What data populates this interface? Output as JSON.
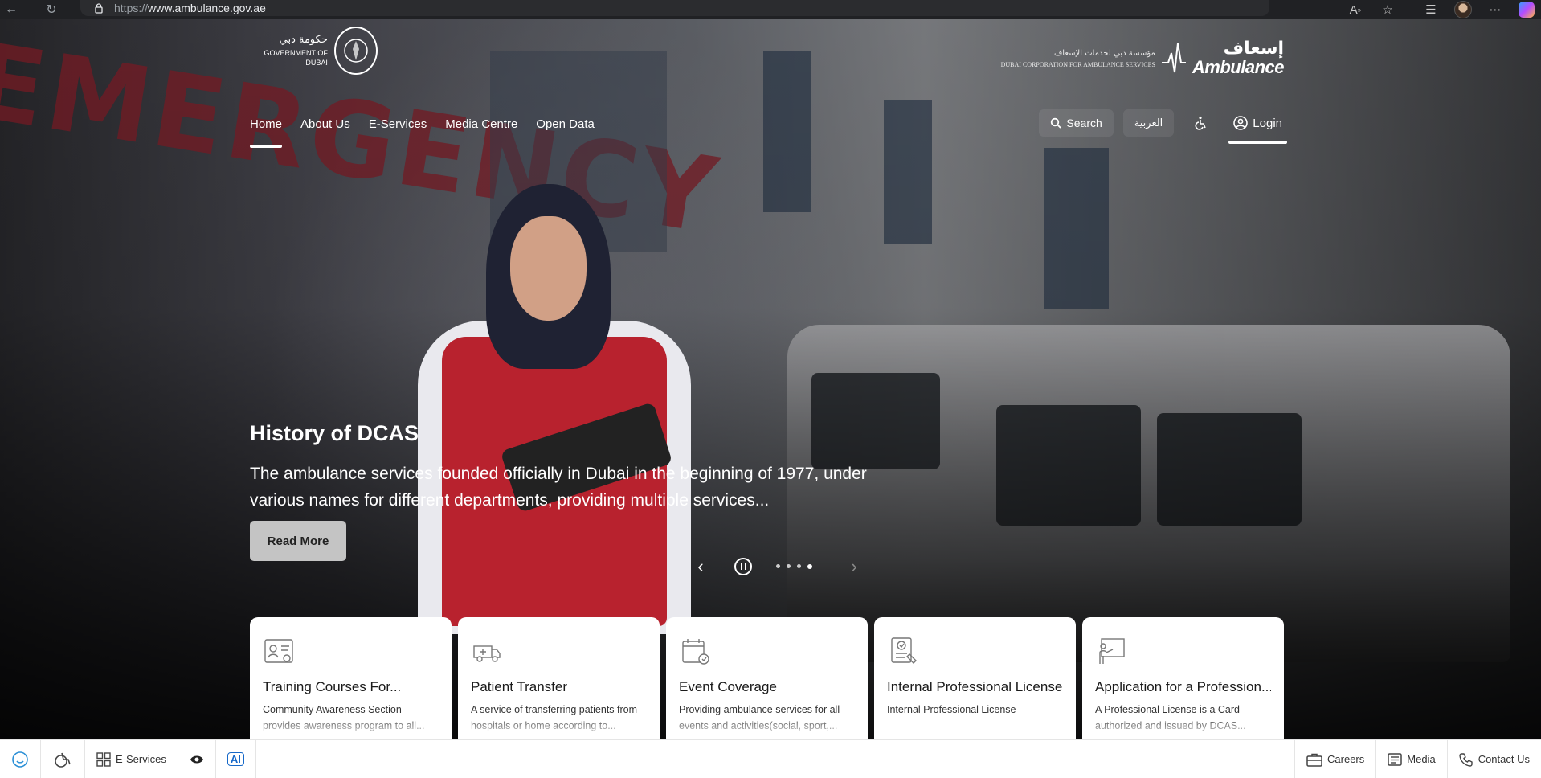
{
  "browser": {
    "url_protocol": "https://",
    "url_host": "www.ambulance.gov.ae"
  },
  "header": {
    "gov_logo_ar": "حكومة دبي",
    "gov_logo_en": "GOVERNMENT OF DUBAI",
    "dcas_corp_ar": "مؤسسة دبي لخدمات الإسعاف",
    "dcas_corp_en": "DUBAI CORPORATION FOR AMBULANCE SERVICES",
    "dcas_brand_ar": "إسعاف",
    "dcas_brand_en": "Ambulance"
  },
  "nav": {
    "items": [
      {
        "label": "Home"
      },
      {
        "label": "About Us"
      },
      {
        "label": "E-Services"
      },
      {
        "label": "Media Centre"
      },
      {
        "label": "Open Data"
      }
    ],
    "search_label": "Search",
    "language_label": "العربية",
    "login_label": "Login"
  },
  "slide": {
    "title": "History of DCAS",
    "description": "The ambulance services founded officially in Dubai in the beginning of 1977, under various names for different departments, providing multiple services...",
    "cta_label": "Read More",
    "background_text": "EMERGENCY"
  },
  "cards": [
    {
      "title": "Training Courses For...",
      "description": "Community Awareness Section provides awareness program to all...",
      "icon": "training-certificate-icon"
    },
    {
      "title": "Patient Transfer",
      "description": "A service of transferring patients from hospitals or home according to...",
      "icon": "ambulance-icon"
    },
    {
      "title": "Event Coverage",
      "description": "Providing ambulance services for all events and activities(social, sport,...",
      "icon": "calendar-icon"
    },
    {
      "title": "Internal Professional License",
      "description": "Internal Professional License",
      "icon": "license-icon"
    },
    {
      "title": "Application for a Profession...",
      "description": "A Professional License is a Card authorized and issued by DCAS...",
      "icon": "presentation-icon"
    }
  ],
  "bottom_bar": {
    "eservices_label": "E-Services",
    "ai_label": "AI",
    "careers_label": "Careers",
    "media_label": "Media",
    "contact_label": "Contact Us"
  }
}
